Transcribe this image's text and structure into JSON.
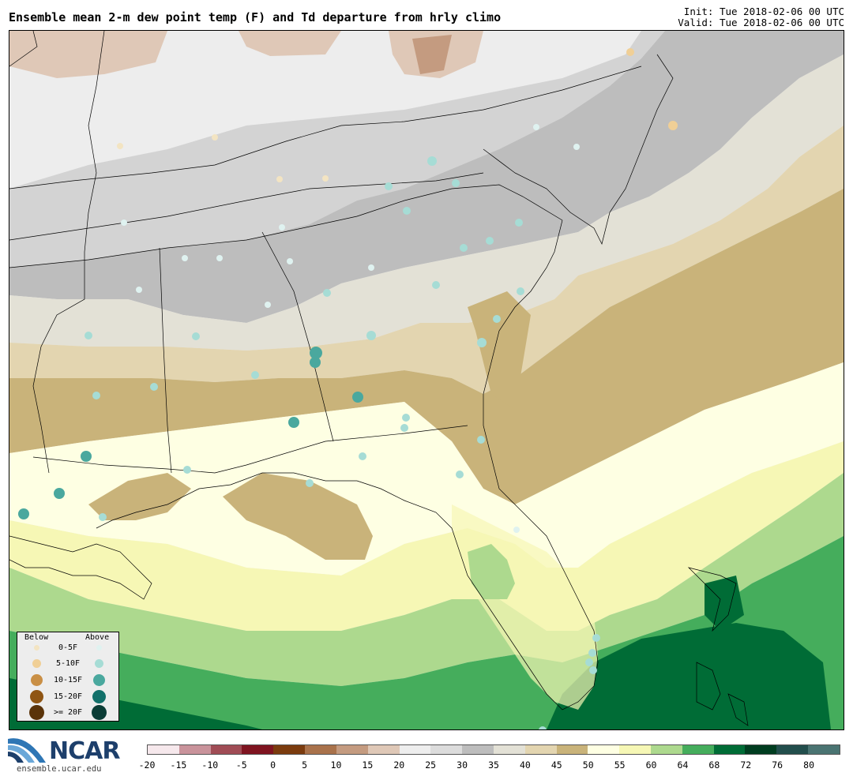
{
  "header": {
    "title": "Ensemble mean 2-m dew point temp (F) and Td departure from hrly climo",
    "init": "Init: Tue 2018-02-06 00 UTC",
    "valid": "Valid: Tue 2018-02-06 00 UTC"
  },
  "legend": {
    "below_label": "Below",
    "above_label": "Above",
    "rows": [
      {
        "label": "0-5F",
        "below_color": "#f3e4c2",
        "above_color": "#dff2f0"
      },
      {
        "label": "5-10F",
        "below_color": "#f0cf96",
        "above_color": "#a6dcd5"
      },
      {
        "label": "10-15F",
        "below_color": "#c98f45",
        "above_color": "#4aa89e"
      },
      {
        "label": "15-20F",
        "below_color": "#8f5513",
        "above_color": "#12706a"
      },
      {
        "label": ">= 20F",
        "below_color": "#5a3309",
        "above_color": "#0b3d36"
      }
    ]
  },
  "logo": {
    "name": "NCAR",
    "site": "ensemble.ucar.edu"
  },
  "colorbar": {
    "ticks": [
      "-20",
      "-15",
      "-10",
      "-5",
      "0",
      "5",
      "10",
      "15",
      "20",
      "25",
      "30",
      "35",
      "40",
      "45",
      "50",
      "55",
      "60",
      "64",
      "68",
      "72",
      "76",
      "80"
    ],
    "colors": [
      "#f6e8ec",
      "#c9939b",
      "#a04c55",
      "#7f1420",
      "#7b3b0e",
      "#a9724b",
      "#c49b80",
      "#dfc8b7",
      "#eeeeee",
      "#dcdcdc",
      "#bdbdbd",
      "#e3e1d6",
      "#e3d5b0",
      "#c9b37a",
      "#feffe3",
      "#f6f7b5",
      "#add98e",
      "#45ad5c",
      "#006c36",
      "#003d20",
      "#224e4c",
      "#4a7472"
    ]
  }
}
